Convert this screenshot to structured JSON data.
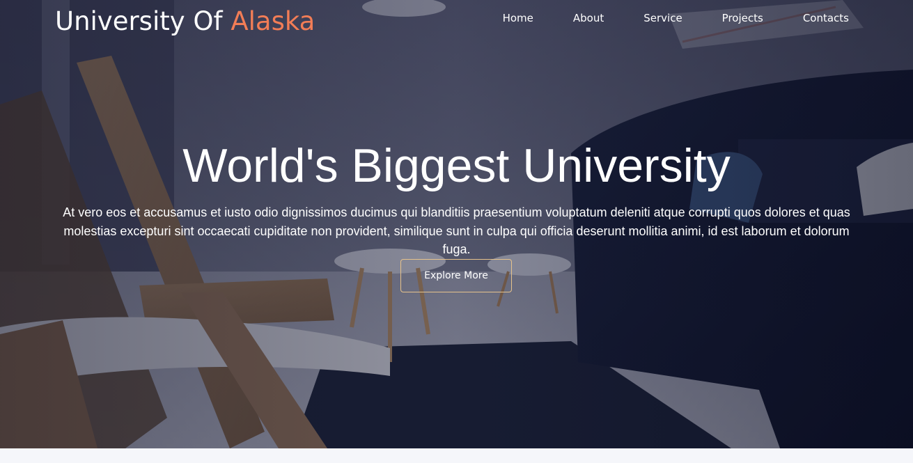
{
  "brand": {
    "name_main": "University Of",
    "name_accent": "Alaska",
    "accent_color": "#f27d56"
  },
  "nav": {
    "items": [
      {
        "label": "Home"
      },
      {
        "label": "About"
      },
      {
        "label": "Service"
      },
      {
        "label": "Projects"
      },
      {
        "label": "Contacts"
      }
    ]
  },
  "hero": {
    "headline": "World's Biggest University",
    "description": "At vero eos et accusamus et iusto odio dignissimos ducimus qui blanditiis praesentium voluptatum deleniti atque corrupti quos dolores et quas molestias excepturi sint occaecati cupiditate non provident, similique sunt in culpa qui officia deserunt mollitia animi, id est laborum et dolorum fuga.",
    "cta_label": "Explore More",
    "cta_border_color": "#e7c38c"
  }
}
